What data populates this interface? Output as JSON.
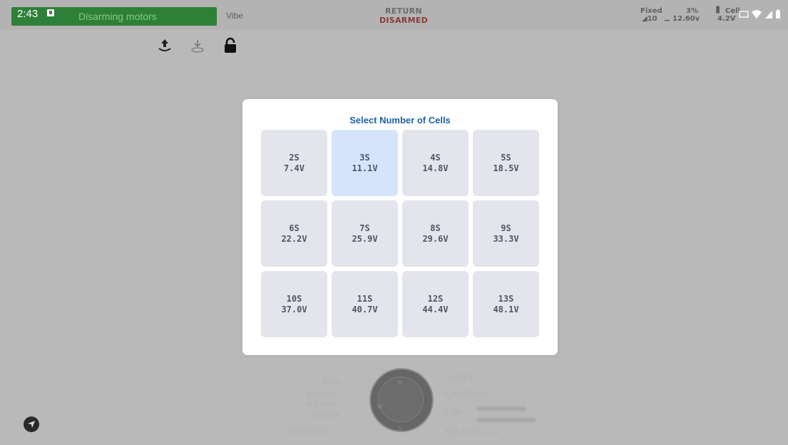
{
  "statusbar": {
    "time": "2:43",
    "message": "Disarming motors",
    "vibe_label": "Vibe",
    "mode": "RETURN",
    "arm_state": "DISARMED",
    "gps_label": "Fixed",
    "gps_count": "10",
    "battery_percent": "3%",
    "battery_voltage": "12.60v",
    "cell_label": "Cell",
    "cell_voltage": "4.2V"
  },
  "dialog": {
    "title": "Select Number of Cells",
    "selected": "3S",
    "options": [
      {
        "cells": "2S",
        "voltage": "7.4V"
      },
      {
        "cells": "3S",
        "voltage": "11.1V"
      },
      {
        "cells": "4S",
        "voltage": "14.8V"
      },
      {
        "cells": "5S",
        "voltage": "18.5V"
      },
      {
        "cells": "6S",
        "voltage": "22.2V"
      },
      {
        "cells": "7S",
        "voltage": "25.9V"
      },
      {
        "cells": "8S",
        "voltage": "29.6V"
      },
      {
        "cells": "9S",
        "voltage": "33.3V"
      },
      {
        "cells": "10S",
        "voltage": "37.0V"
      },
      {
        "cells": "11S",
        "voltage": "40.7V"
      },
      {
        "cells": "12S",
        "voltage": "44.4V"
      },
      {
        "cells": "13S",
        "voltage": "48.1V"
      }
    ]
  },
  "telemetry": {
    "distance": "0.0m",
    "ground_speed": "g:0.0m/s",
    "air_speed": "a:0.0m/s",
    "flight_time": "20:55:59",
    "throttle_climb": "0% 0.0m/s",
    "temperature": "34.98°C",
    "altitude_vspeed": "0.0m 0.0m/s",
    "home_distance": "2.0m",
    "agl": "AGL:0.0 GL:2.1",
    "compass_n": "N",
    "compass_w": "W",
    "compass_s": "S"
  },
  "colors": {
    "accent_title": "#1f63a9",
    "selected_cell": "#d6e4fb",
    "cell": "#e3e4ec",
    "message_bar": "#1f7a2b",
    "disarmed": "#8a3a3a"
  }
}
